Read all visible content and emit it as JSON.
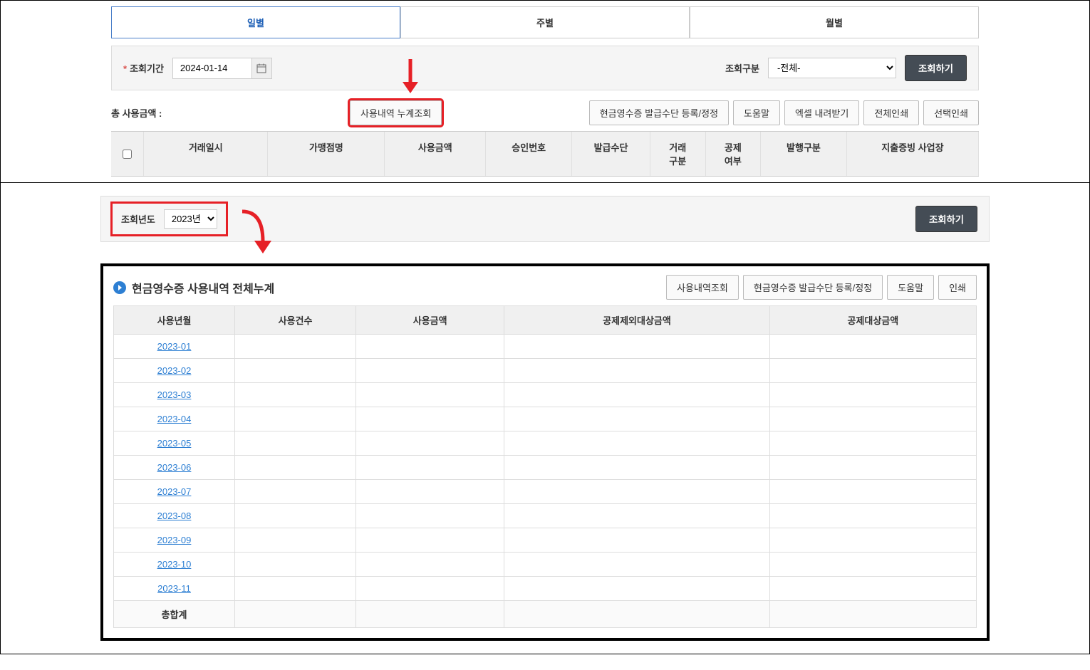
{
  "tabs": {
    "daily": "일별",
    "weekly": "주별",
    "monthly": "월별"
  },
  "top_filter": {
    "period_label": "조회기간",
    "date_value": "2024-01-14",
    "category_label": "조회구분",
    "category_value": "-전체-",
    "search_btn": "조회하기"
  },
  "total_row": {
    "label": "총 사용금액 :",
    "btn_cumulative": "사용내역 누계조회",
    "btn_register": "현금영수증 발급수단 등록/정정",
    "btn_help": "도움말",
    "btn_excel": "엑셀 내려받기",
    "btn_print_all": "전체인쇄",
    "btn_print_sel": "선택인쇄"
  },
  "table1_headers": {
    "datetime": "거래일시",
    "merchant": "가맹점명",
    "amount": "사용금액",
    "approval": "승인번호",
    "method": "발급수단",
    "type": "거래\n구분",
    "deduct": "공제\n여부",
    "issue": "발행구분",
    "business": "지출증빙 사업장"
  },
  "bottom_filter": {
    "year_label": "조회년도",
    "year_value": "2023년",
    "search_btn": "조회하기"
  },
  "panel": {
    "title": "현금영수증 사용내역 전체누계",
    "btn_detail": "사용내역조회",
    "btn_register": "현금영수증 발급수단 등록/정정",
    "btn_help": "도움말",
    "btn_print": "인쇄"
  },
  "summary_headers": {
    "month": "사용년월",
    "count": "사용건수",
    "amount": "사용금액",
    "excluded": "공제제외대상금액",
    "deductible": "공제대상금액"
  },
  "summary_rows": [
    {
      "month": "2023-01"
    },
    {
      "month": "2023-02"
    },
    {
      "month": "2023-03"
    },
    {
      "month": "2023-04"
    },
    {
      "month": "2023-05"
    },
    {
      "month": "2023-06"
    },
    {
      "month": "2023-07"
    },
    {
      "month": "2023-08"
    },
    {
      "month": "2023-09"
    },
    {
      "month": "2023-10"
    },
    {
      "month": "2023-11"
    }
  ],
  "summary_total_label": "총합계"
}
